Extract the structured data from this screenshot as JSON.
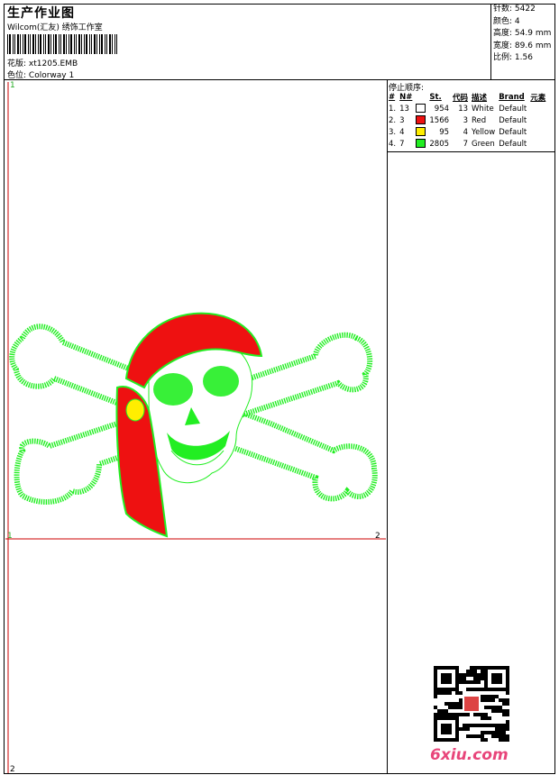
{
  "header": {
    "title": "生产作业图",
    "studio": "Wilcom(汇友) 绣饰工作室",
    "pattern_label": "花版:",
    "pattern_value": "xt1205.EMB",
    "colorway_label": "色位:",
    "colorway_value": "Colorway 1"
  },
  "stats": [
    {
      "label": "针数:",
      "value": "5422"
    },
    {
      "label": "颜色:",
      "value": "4"
    },
    {
      "label": "高度:",
      "value": "54.9 mm"
    },
    {
      "label": "宽度:",
      "value": "89.6 mm"
    },
    {
      "label": "比例:",
      "value": "1.56"
    }
  ],
  "legend": {
    "title": "停止顺序:",
    "headers": [
      "#",
      "N#",
      "St.",
      "代码",
      "描述",
      "Brand",
      "元素"
    ],
    "rows": [
      {
        "idx": "1.",
        "n": "13",
        "color": "#ffffff",
        "st": "954",
        "code": "13",
        "desc": "White",
        "brand": "Default"
      },
      {
        "idx": "2.",
        "n": "3",
        "color": "#ee1111",
        "st": "1566",
        "code": "3",
        "desc": "Red",
        "brand": "Default"
      },
      {
        "idx": "3.",
        "n": "4",
        "color": "#ffee00",
        "st": "95",
        "code": "4",
        "desc": "Yellow",
        "brand": "Default"
      },
      {
        "idx": "4.",
        "n": "7",
        "color": "#22ee22",
        "st": "2805",
        "code": "7",
        "desc": "Green",
        "brand": "Default"
      }
    ]
  },
  "axis": {
    "top_left": "1",
    "mid_left": "1",
    "mid_right": "2",
    "bottom_left": "2"
  },
  "watermark": "6xiu.com",
  "colors": {
    "axis_line": "#cc0000",
    "thread_green": "#22ee22",
    "thread_red": "#ee1111",
    "thread_yellow": "#ffee00"
  }
}
